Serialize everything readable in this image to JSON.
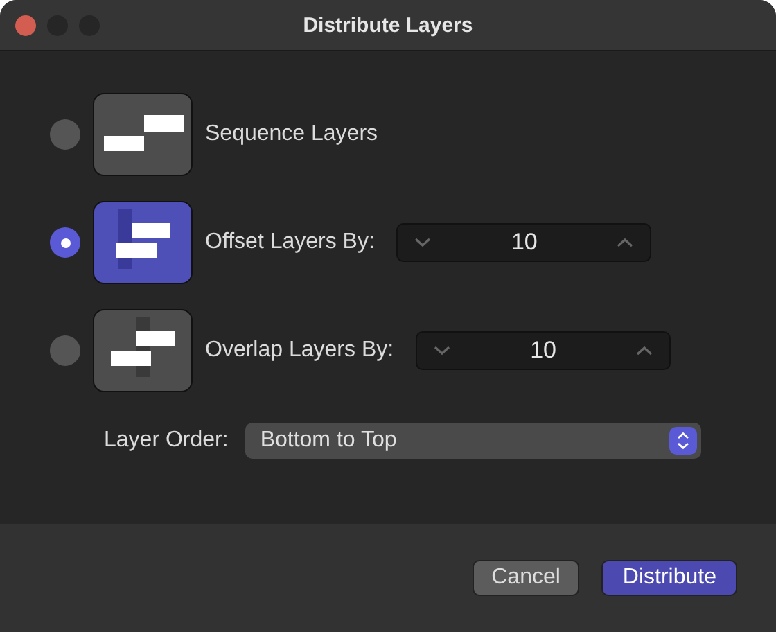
{
  "window": {
    "title": "Distribute Layers"
  },
  "options": [
    {
      "kind": "sequence",
      "label": "Sequence Layers",
      "selected": false
    },
    {
      "kind": "offset",
      "label": "Offset Layers By:",
      "selected": true,
      "value": "10"
    },
    {
      "kind": "overlap",
      "label": "Overlap Layers By:",
      "selected": false,
      "value": "10"
    }
  ],
  "layer_order": {
    "label": "Layer Order:",
    "value": "Bottom to Top"
  },
  "buttons": [
    {
      "label": "Cancel",
      "kind": "secondary"
    },
    {
      "label": "Distribute",
      "kind": "primary"
    }
  ]
}
